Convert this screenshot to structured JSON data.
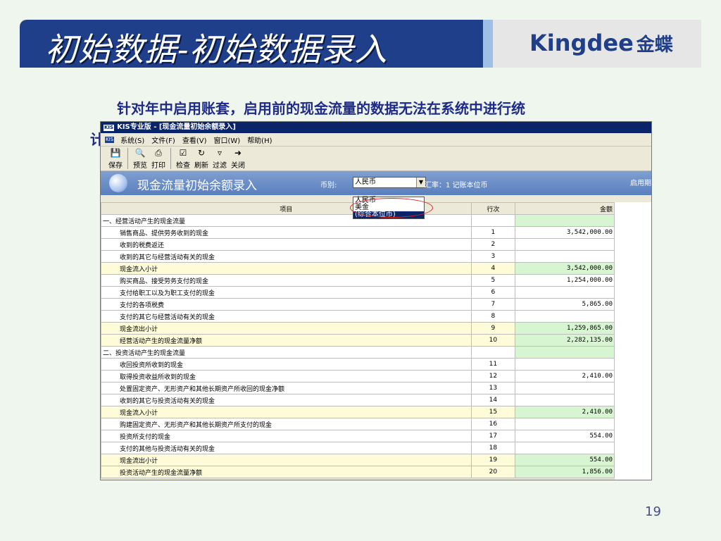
{
  "slide": {
    "title": "初始数据-初始数据录入",
    "logo_en": "Kingdee",
    "logo_cn": "金蝶",
    "subtitle": "针对年中启用账套，启用前的现金流量的数据无法在系统中进行统",
    "subtitle_cont": "计",
    "page_number": "19"
  },
  "window": {
    "title": "KIS专业版 - [现金流量初始余额录入]",
    "badge": "KIS",
    "menus": [
      "系统(S)",
      "文件(F)",
      "查看(V)",
      "窗口(W)",
      "帮助(H)"
    ],
    "toolbar": [
      {
        "label": "保存",
        "icon": "save-icon"
      },
      {
        "label": "预览",
        "icon": "preview-icon"
      },
      {
        "label": "打印",
        "icon": "print-icon"
      },
      {
        "label": "检查",
        "icon": "check-icon"
      },
      {
        "label": "刷新",
        "icon": "refresh-icon"
      },
      {
        "label": "过滤",
        "icon": "filter-icon"
      },
      {
        "label": "关闭",
        "icon": "close-icon"
      }
    ],
    "banner": {
      "title": "现金流量初始余额录入",
      "currency_label": "币别:",
      "currency_value": "人民币",
      "rate_text": "汇率：1 记账本位币",
      "enable_text": "启用期"
    },
    "dropdown_options": [
      "人民币",
      "美金",
      "(综合本位币)"
    ],
    "grid": {
      "headers": [
        "项目",
        "行次",
        "金额"
      ],
      "rows": [
        {
          "item": "一、经营活动产生的现金流量",
          "line": "",
          "amount": "",
          "type": "section"
        },
        {
          "item": "销售商品、提供劳务收到的现金",
          "line": "1",
          "amount": "3,542,000.00",
          "type": "normal"
        },
        {
          "item": "收到的税费返还",
          "line": "2",
          "amount": "",
          "type": "normal"
        },
        {
          "item": "收到的其它与经营活动有关的现金",
          "line": "3",
          "amount": "",
          "type": "normal"
        },
        {
          "item": "现金流入小计",
          "line": "4",
          "amount": "3,542,000.00",
          "type": "subtotal"
        },
        {
          "item": "购买商品、接受劳务支付的现金",
          "line": "5",
          "amount": "1,254,000.00",
          "type": "normal"
        },
        {
          "item": "支付给职工以及为职工支付的现金",
          "line": "6",
          "amount": "",
          "type": "normal"
        },
        {
          "item": "支付的各项税费",
          "line": "7",
          "amount": "5,865.00",
          "type": "normal"
        },
        {
          "item": "支付的其它与经营活动有关的现金",
          "line": "8",
          "amount": "",
          "type": "normal"
        },
        {
          "item": "现金流出小计",
          "line": "9",
          "amount": "1,259,865.00",
          "type": "subtotal"
        },
        {
          "item": "经营活动产生的现金流量净额",
          "line": "10",
          "amount": "2,282,135.00",
          "type": "subtotal"
        },
        {
          "item": "二、投资活动产生的现金流量",
          "line": "",
          "amount": "",
          "type": "section"
        },
        {
          "item": "收回投资所收到的现金",
          "line": "11",
          "amount": "",
          "type": "normal"
        },
        {
          "item": "取得投资收益所收到的现金",
          "line": "12",
          "amount": "2,410.00",
          "type": "normal"
        },
        {
          "item": "处置固定资产、无形资产和其他长期资产所收回的现金净额",
          "line": "13",
          "amount": "",
          "type": "normal"
        },
        {
          "item": "收到的其它与投资活动有关的现金",
          "line": "14",
          "amount": "",
          "type": "normal"
        },
        {
          "item": "现金流入小计",
          "line": "15",
          "amount": "2,410.00",
          "type": "subtotal"
        },
        {
          "item": "购建固定资产、无形资产和其他长期资产所支付的现金",
          "line": "16",
          "amount": "",
          "type": "normal"
        },
        {
          "item": "投资所支付的现金",
          "line": "17",
          "amount": "554.00",
          "type": "normal"
        },
        {
          "item": "支付的其他与投资活动有关的现金",
          "line": "18",
          "amount": "",
          "type": "normal"
        },
        {
          "item": "现金流出小计",
          "line": "19",
          "amount": "554.00",
          "type": "subtotal"
        },
        {
          "item": "投资活动产生的现金流量净额",
          "line": "20",
          "amount": "1,856.00",
          "type": "subtotal"
        }
      ]
    }
  }
}
